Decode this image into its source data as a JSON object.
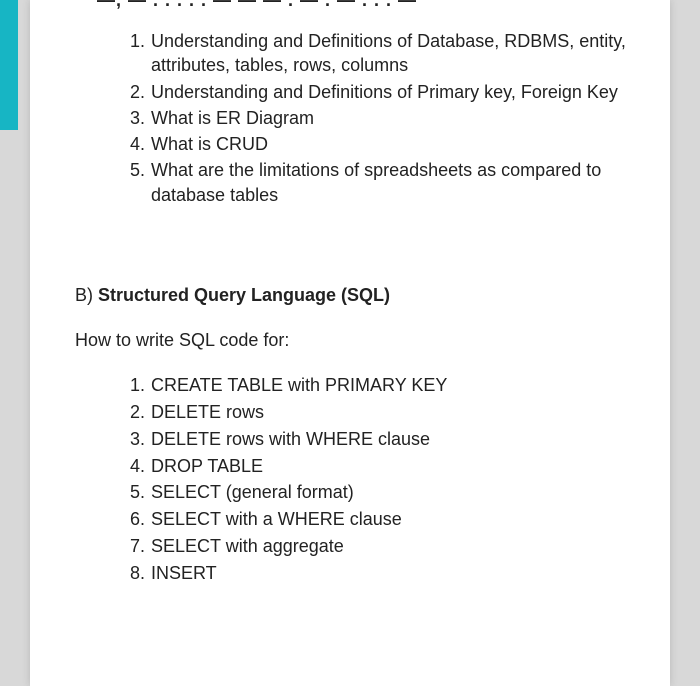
{
  "cutoff_title": "—,  — . . . . . — — — . — . — . . . —",
  "section_a": {
    "items": [
      {
        "num": "1.",
        "text": "Understanding and Definitions of Database, RDBMS, entity, attributes, tables, rows, columns"
      },
      {
        "num": "2.",
        "text": "Understanding and Definitions of Primary key, Foreign Key"
      },
      {
        "num": "3.",
        "text": "What is ER Diagram"
      },
      {
        "num": "4.",
        "text": "What is CRUD"
      },
      {
        "num": "5.",
        "text": "What are the limitations of spreadsheets as compared to database tables"
      }
    ]
  },
  "section_b": {
    "label": "B)",
    "title": "Structured Query Language (SQL)",
    "subtitle": "How to write SQL code for:",
    "items": [
      {
        "num": "1.",
        "text": "CREATE TABLE with PRIMARY KEY"
      },
      {
        "num": "2.",
        "text": "DELETE rows"
      },
      {
        "num": "3.",
        "text": "DELETE rows with WHERE clause"
      },
      {
        "num": "4.",
        "text": "DROP TABLE"
      },
      {
        "num": "5.",
        "text": "SELECT (general format)"
      },
      {
        "num": "6.",
        "text": "SELECT with a WHERE clause"
      },
      {
        "num": "7.",
        "text": "SELECT with aggregate"
      },
      {
        "num": "8.",
        "text": "INSERT"
      }
    ]
  }
}
